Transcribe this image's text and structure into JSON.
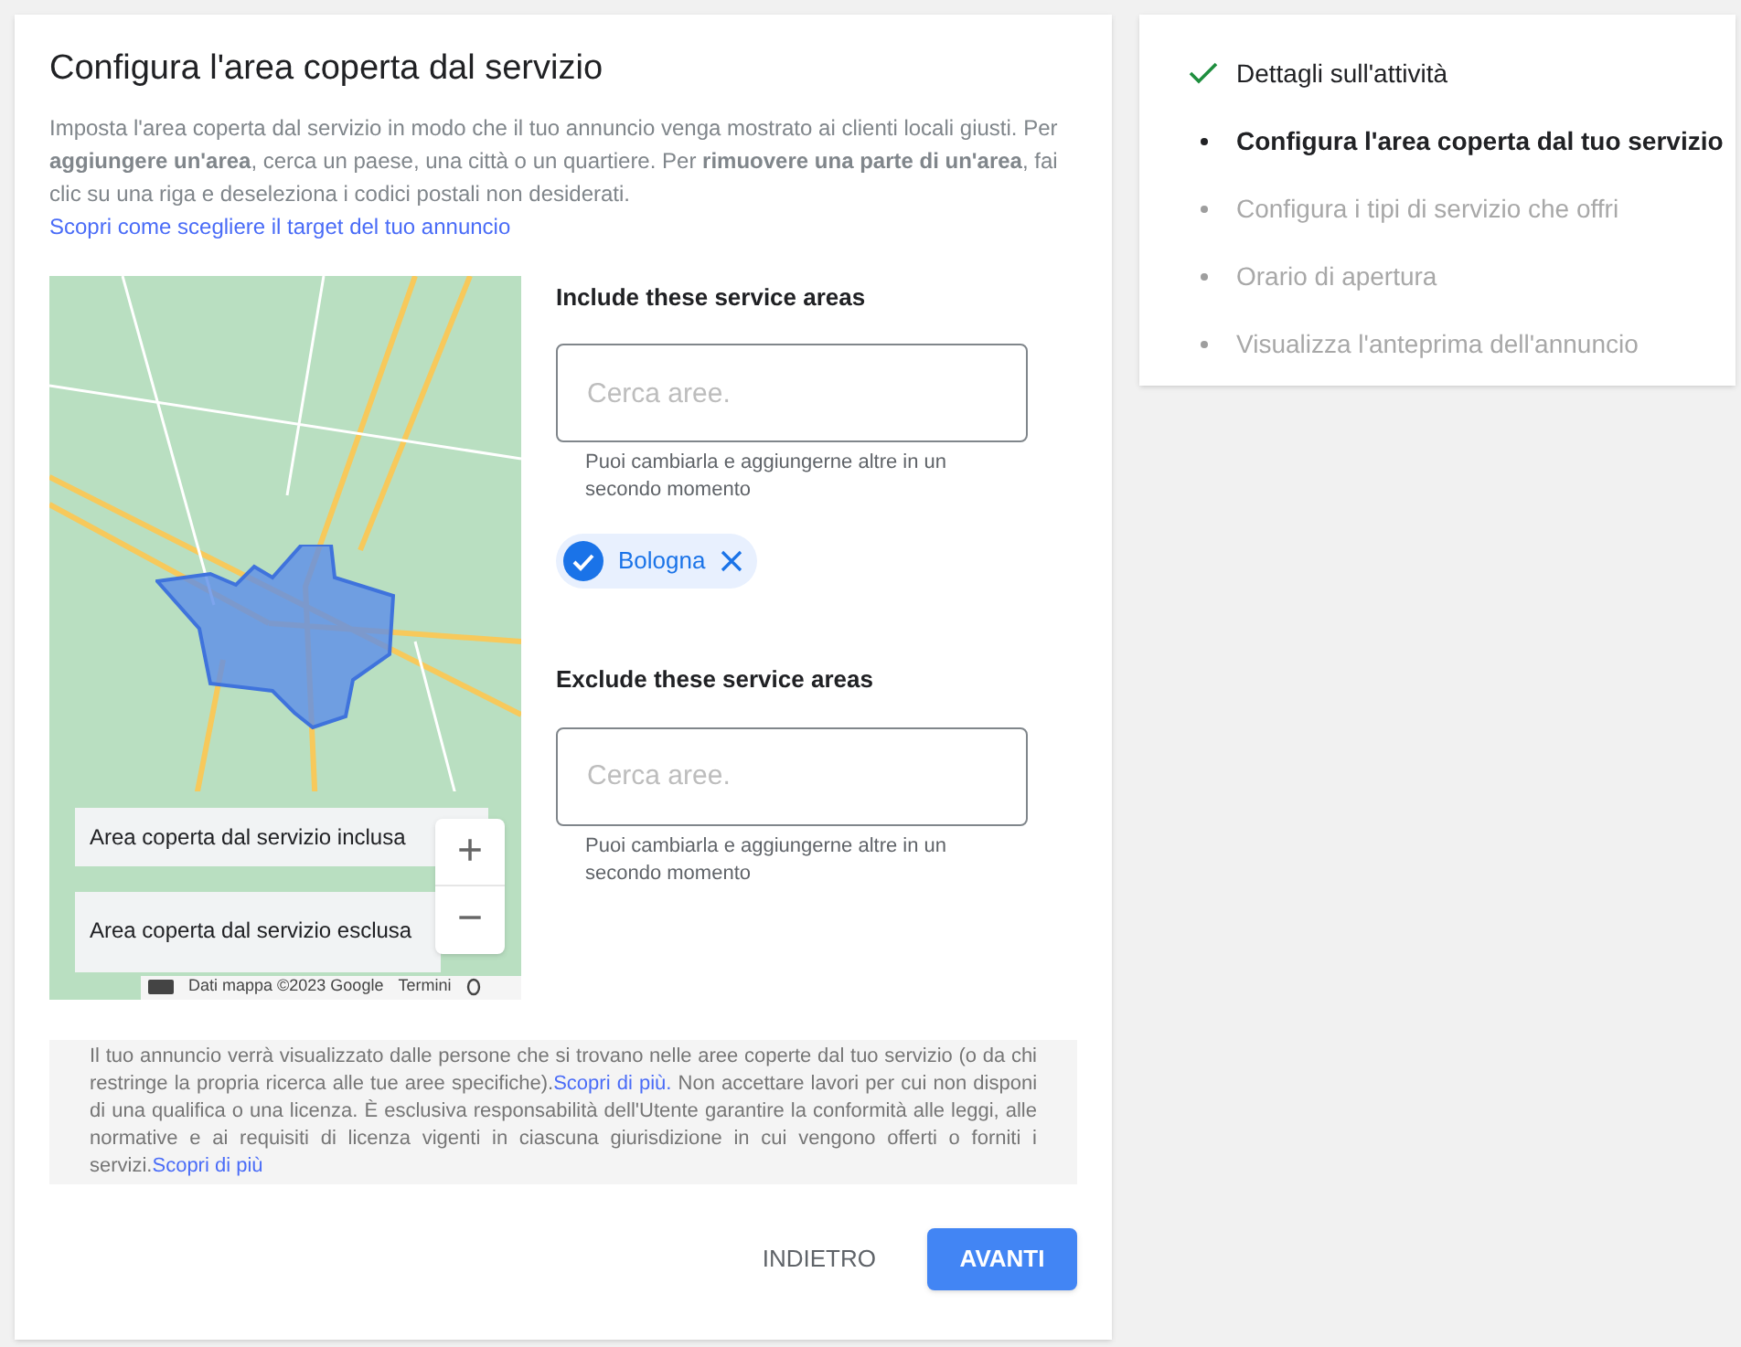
{
  "main": {
    "title": "Configura l'area coperta dal servizio",
    "intro": {
      "text": "Imposta l'area coperta dal servizio in modo che il tuo annuncio venga mostrato ai clienti locali giusti. Per **aggiungere un'area**, cerca un paese, una città o un quartiere. Per **rimuovere una parte di un'area**, fai clic su una riga e deseleziona i codici postali non desiderati.",
      "link": "Scopri come scegliere il target del tuo annuncio"
    },
    "map": {
      "legend": [
        "Area coperta dal servizio inclusa",
        "Area coperta dal servizio esclusa"
      ],
      "zoom_in": "+",
      "zoom_out": "−",
      "attribution": "Dati mappa ©2023 Google",
      "terms": "Termini"
    },
    "include": {
      "heading": "Include these service areas",
      "placeholder": "Cerca aree.",
      "hint": "Puoi cambiarla e aggiungerne altre in un secondo momento",
      "chips": [
        {
          "label": "Bologna",
          "selected": true
        }
      ]
    },
    "exclude": {
      "heading": "Exclude these service areas",
      "placeholder": "Cerca aree.",
      "hint": "Puoi cambiarla e aggiungerne altre in un secondo momento"
    },
    "notice": [
      {
        "kind": "text",
        "text": "Il tuo annuncio verrà visualizzato dalle persone che si trovano nelle aree coperte dal tuo servizio (o da chi restringe la propria ricerca alle tue aree specifiche)."
      },
      {
        "kind": "link",
        "text": "Scopri di più."
      },
      {
        "kind": "text",
        "text": " Non accettare lavori per cui non disponi di una qualifica o una licenza. È esclusiva responsabilità dell'Utente garantire la conformità alle leggi, alle normative e ai requisiti di licenza vigenti in ciascuna giurisdizione in cui vengono offerti o forniti i servizi."
      },
      {
        "kind": "link",
        "text": "Scopri di più"
      }
    ],
    "buttons": [
      {
        "label": "INDIETRO",
        "kind": "text"
      },
      {
        "label": "AVANTI",
        "kind": "primary"
      }
    ]
  },
  "steps": [
    {
      "label": "Dettagli sull'attività",
      "done": true,
      "current": false
    },
    {
      "label": "Configura l'area coperta dal tuo servizio",
      "done": false,
      "current": true
    },
    {
      "label": "Configura i tipi di servizio che offri",
      "done": false,
      "current": false
    },
    {
      "label": "Orario di apertura",
      "done": false,
      "current": false
    },
    {
      "label": "Visualizza l'anteprima dell'annuncio",
      "done": false,
      "current": false
    }
  ]
}
